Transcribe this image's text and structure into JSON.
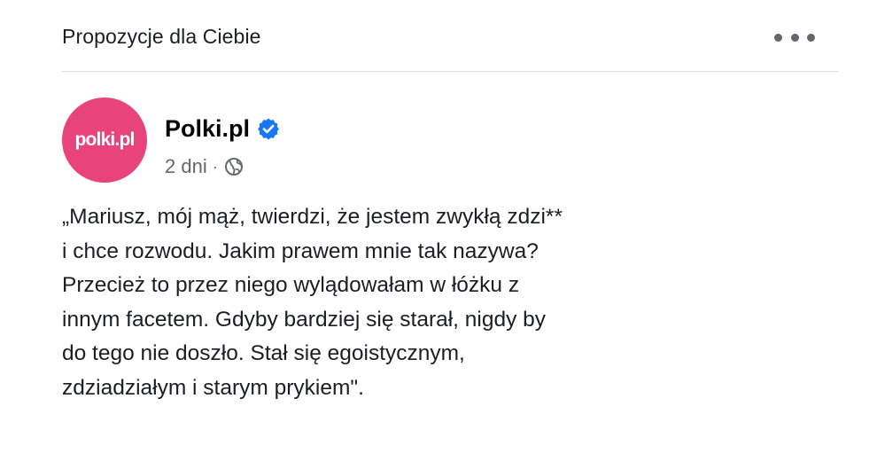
{
  "section": {
    "title": "Propozycje dla Ciebie",
    "more_label": "..."
  },
  "post": {
    "avatar_text": "polki.pl",
    "page_name": "Polki.pl",
    "verified": true,
    "time": "2 dni",
    "separator": "·",
    "audience_icon": "globe-icon",
    "text_lines": [
      "„Mariusz, mój mąż, twierdzi, że jestem zwykłą zdzi**",
      "i chce rozwodu. Jakim prawem mnie tak nazywa?",
      "Przecież to przez niego wylądowałam w łóżku z",
      "innym facetem. Gdyby bardziej się starał, nigdy by",
      "do tego nie doszło. Stał się egoistycznym,",
      "zdziadziałym i starym prykiem\"."
    ]
  },
  "colors": {
    "avatar_bg": "#e8437a",
    "verified_blue": "#1877f2",
    "secondary_text": "#65676b",
    "divider": "#dadde1"
  }
}
